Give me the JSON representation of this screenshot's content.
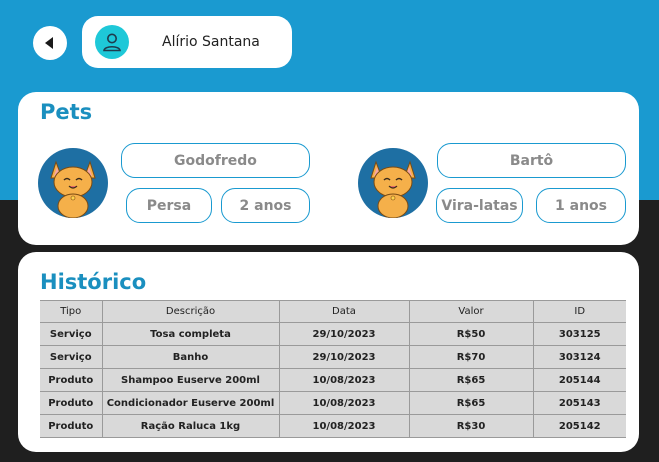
{
  "header": {
    "user_name": "Alírio Santana"
  },
  "pets_section": {
    "title": "Pets",
    "pets": [
      {
        "name": "Godofredo",
        "breed": "Persa",
        "age": "2 anos"
      },
      {
        "name": "Bartô",
        "breed": "Vira-latas",
        "age": "1 anos"
      }
    ]
  },
  "history_section": {
    "title": "Histórico",
    "columns": [
      "Tipo",
      "Descrição",
      "Data",
      "Valor",
      "ID"
    ],
    "rows": [
      [
        "Serviço",
        "Tosa completa",
        "29/10/2023",
        "R$50",
        "303125"
      ],
      [
        "Serviço",
        "Banho",
        "29/10/2023",
        "R$70",
        "303124"
      ],
      [
        "Produto",
        "Shampoo Euserve 200ml",
        "10/08/2023",
        "R$65",
        "205144"
      ],
      [
        "Produto",
        "Condicionador Euserve 200ml",
        "10/08/2023",
        "R$65",
        "205143"
      ],
      [
        "Produto",
        "Ração Raluca 1kg",
        "10/08/2023",
        "R$30",
        "205142"
      ]
    ]
  },
  "colors": {
    "accent": "#1a9ad0",
    "title": "#1a8fbf",
    "avatar": "#1ec8d8",
    "background_dark": "#1f1f1f"
  },
  "icons": [
    "back-arrow-icon",
    "user-icon",
    "cat-icon"
  ]
}
